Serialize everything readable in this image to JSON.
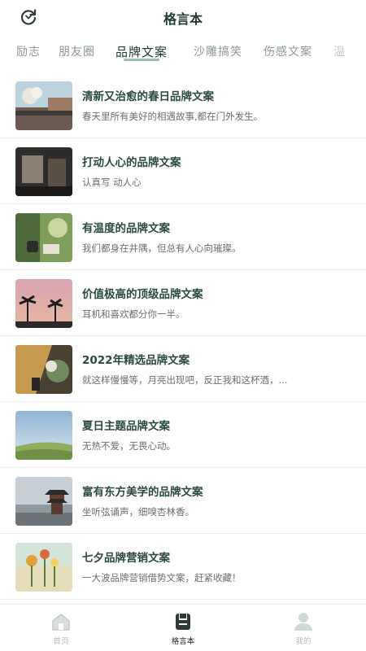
{
  "header": {
    "title": "格言本",
    "refresh_icon": "refresh-icon"
  },
  "tabs": [
    {
      "label": "励志"
    },
    {
      "label": "朋友圈"
    },
    {
      "label": "品牌文案",
      "active": true
    },
    {
      "label": "沙雕搞笑"
    },
    {
      "label": "伤感文案"
    },
    {
      "label": "温"
    }
  ],
  "list": [
    {
      "title": "清新又治愈的春日品牌文案",
      "subtitle": "春天里所有美好的相遇故事,都在门外发生。"
    },
    {
      "title": "打动人心的品牌文案",
      "subtitle": "认真写 动人心"
    },
    {
      "title": "有温度的品牌文案",
      "subtitle": "我们都身在井隅，但总有人心向璀璨。"
    },
    {
      "title": "价值极高的顶级品牌文案",
      "subtitle": "耳机和喜欢都分你一半。"
    },
    {
      "title": "2022年精选品牌文案",
      "subtitle": "就这样慢慢等，月亮出现吧，反正我和这杯酒，..."
    },
    {
      "title": "夏日主题品牌文案",
      "subtitle": "无热不爱，无畏心动。"
    },
    {
      "title": "富有东方美学的品牌文案",
      "subtitle": "坐听弦诵声，细嗅杏林香。"
    },
    {
      "title": "七夕品牌营销文案",
      "subtitle": "一大波品牌营销借势文案，赶紧收藏！"
    }
  ],
  "bottom_nav": [
    {
      "label": "首页",
      "icon": "home-icon"
    },
    {
      "label": "格言本",
      "icon": "notebook-icon",
      "active": true
    },
    {
      "label": "我的",
      "icon": "user-icon"
    }
  ],
  "colors": {
    "accent": "#6fa48a",
    "title_text": "#2b4a3c",
    "inactive_tab": "#8c9a92"
  }
}
